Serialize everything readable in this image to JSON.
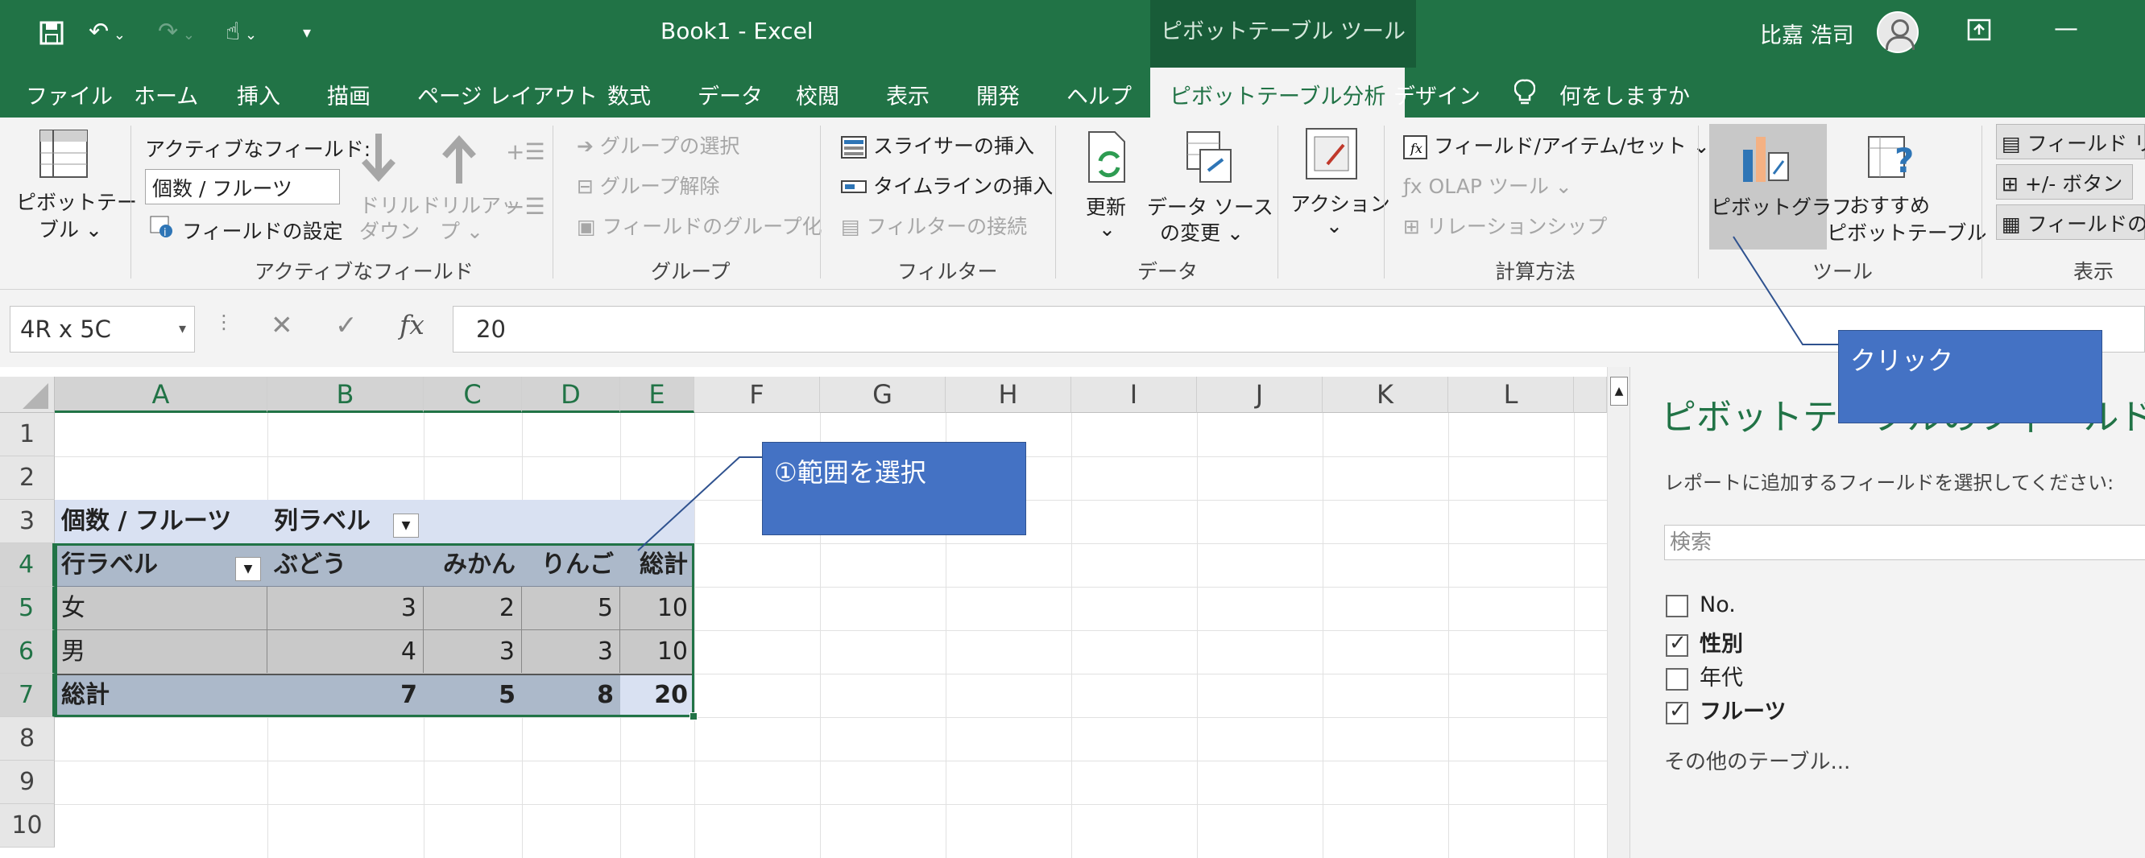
{
  "window": {
    "title": "Book1  -  Excel",
    "context_header": "ピボットテーブル ツール",
    "user": "比嘉 浩司"
  },
  "tabs": [
    "ファイル",
    "ホーム",
    "挿入",
    "描画",
    "ページ レイアウト",
    "数式",
    "データ",
    "校閲",
    "表示",
    "開発",
    "ヘルプ",
    "ピボットテーブル分析",
    "デザイン",
    "何をしますか"
  ],
  "ribbon": {
    "pivottable_btn": "ピボットテー",
    "pivottable_btn2": "ブル ⌄",
    "active_field_label": "アクティブなフィールド:",
    "active_field_value": "個数 / フルーツ",
    "field_settings": "フィールドの設定",
    "drill_down": "ドリル",
    "drill_down2": "ダウン",
    "drill_up": "ドリルアッ",
    "drill_up2": "プ ⌄",
    "group_active_field": "アクティブなフィールド",
    "group_select": "グループの選択",
    "ungroup": "グループ解除",
    "group_field": "フィールドのグループ化",
    "group_group": "グループ",
    "insert_slicer": "スライサーの挿入",
    "insert_timeline": "タイムラインの挿入",
    "filter_connections": "フィルターの接続",
    "group_filter": "フィルター",
    "refresh": "更新",
    "refresh2": "⌄",
    "change_source": "データ ソース",
    "change_source2": "の変更 ⌄",
    "group_data": "データ",
    "actions": "アクション",
    "actions2": "⌄",
    "fields_items_sets": "フィールド/アイテム/セット ⌄",
    "olap_tools": "OLAP ツール ⌄",
    "relationships": "リレーションシップ",
    "group_calc": "計算方法",
    "pivot_chart": "ピボットグラフ",
    "recommended": "おすすめ",
    "recommended2": "ピボットテーブル",
    "group_tools": "ツール",
    "field_list": "フィールド リス",
    "plus_minus": "+/- ボタン",
    "field_headers": "フィールドの見",
    "group_show": "表示"
  },
  "formula_bar": {
    "name_box": "4R x 5C",
    "cancel": "✕",
    "enter": "✓",
    "fx": "fx",
    "value": "20"
  },
  "columns": [
    "A",
    "B",
    "C",
    "D",
    "E",
    "F",
    "G",
    "H",
    "I",
    "J",
    "K",
    "L"
  ],
  "rows": [
    "1",
    "2",
    "3",
    "4",
    "5",
    "6",
    "7",
    "8",
    "9",
    "10"
  ],
  "pivot": {
    "value_label": "個数 / フルーツ",
    "col_labels": "列ラベル",
    "row_labels": "行ラベル",
    "headers": [
      "ぶどう",
      "みかん",
      "りんご",
      "総計"
    ],
    "data": [
      {
        "label": "女",
        "values": [
          "3",
          "2",
          "5",
          "10"
        ]
      },
      {
        "label": "男",
        "values": [
          "4",
          "3",
          "3",
          "10"
        ]
      }
    ],
    "total": {
      "label": "総計",
      "values": [
        "7",
        "5",
        "8",
        "20"
      ]
    }
  },
  "callouts": {
    "select_range": "①範囲を選択",
    "click": "クリック"
  },
  "pane": {
    "title": "ピボットテーブルのフィールド",
    "subtitle": "レポートに追加するフィールドを選択してください:",
    "search_placeholder": "検索",
    "fields": [
      {
        "name": "No.",
        "checked": false
      },
      {
        "name": "性別",
        "checked": true
      },
      {
        "name": "年代",
        "checked": false
      },
      {
        "name": "フルーツ",
        "checked": true
      }
    ],
    "more_tables": "その他のテーブル..."
  },
  "colors": {
    "excel_green": "#217346",
    "pivot_header": "#acb9ca",
    "pivot_row": "#d9e1f2",
    "callout": "#4472c4"
  }
}
